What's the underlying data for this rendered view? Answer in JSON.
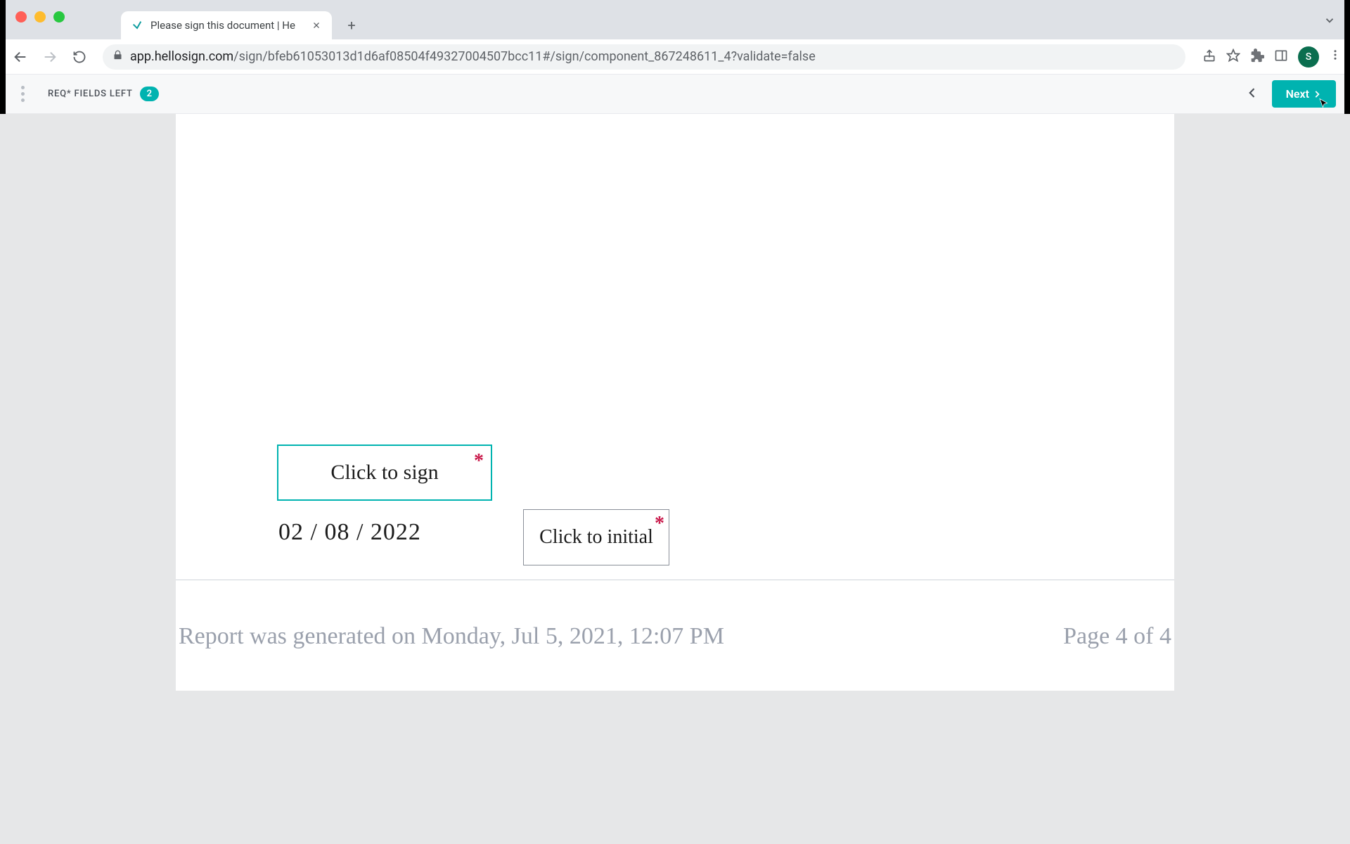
{
  "browser": {
    "tab_title": "Please sign this document | He",
    "url_domain": "app.hellosign.com",
    "url_path": "/sign/bfeb61053013d1d6af08504f49327004507bcc11#/sign/component_867248611_4?validate=false",
    "avatar_initial": "S"
  },
  "header": {
    "req_label": "REQ* FIELDS LEFT",
    "req_count": "2",
    "next_label": "Next"
  },
  "document": {
    "sign_label": "Click to sign",
    "initial_label": "Click to initial",
    "date_value": "02 / 08 / 2022",
    "footer_generated": "Report was generated on Monday, Jul 5, 2021, 12:07 PM",
    "footer_page": "Page 4 of 4"
  }
}
